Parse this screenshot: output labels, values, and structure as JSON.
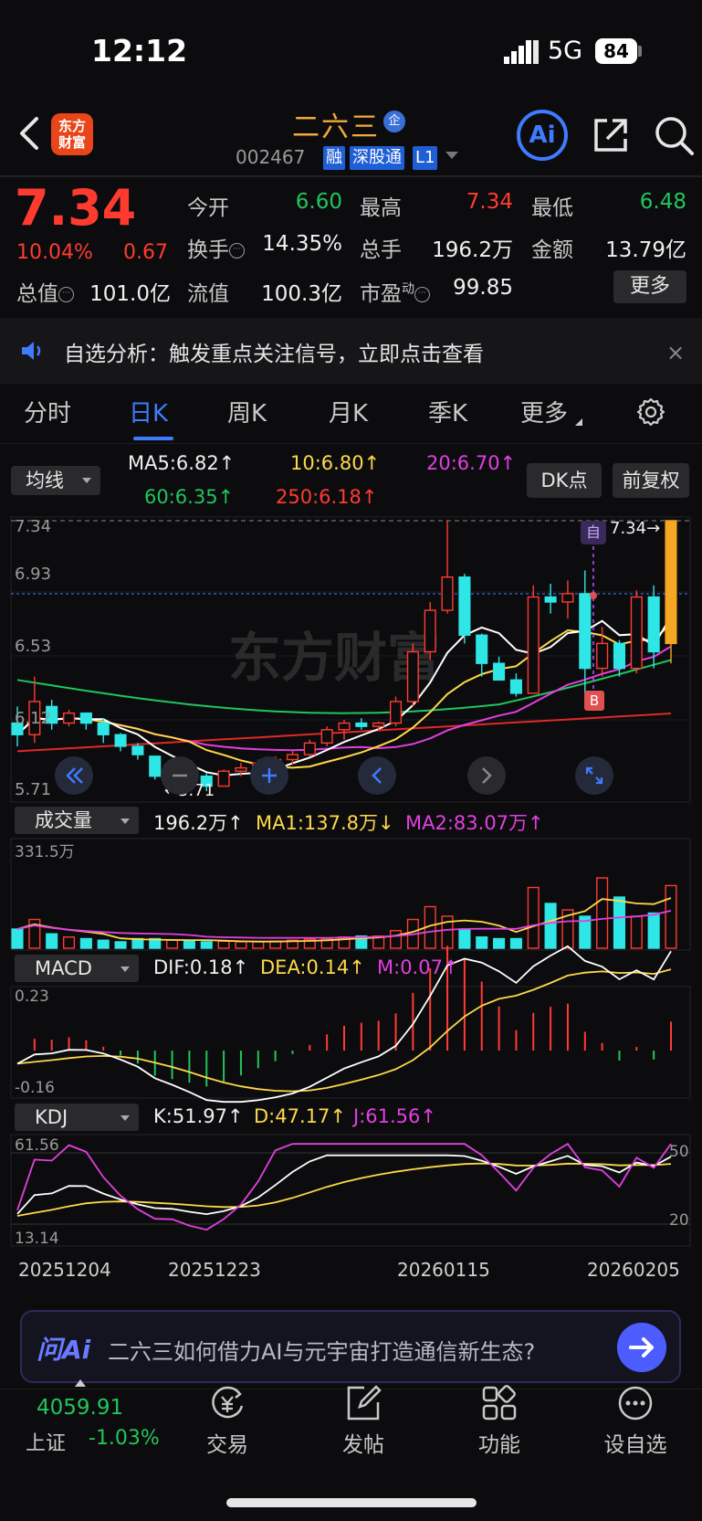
{
  "status_bar": {
    "time": "12:12",
    "network": "5G",
    "battery": "84"
  },
  "header": {
    "logo_line1": "东方",
    "logo_line2": "财富",
    "stock_name": "二六三",
    "qi_badge": "企",
    "stock_code": "002467",
    "tags": [
      "融",
      "深股通",
      "L1"
    ],
    "ai_label": "Ai"
  },
  "quote": {
    "price": "7.34",
    "change_pct": "10.04%",
    "change_abs": "0.67",
    "open_label": "今开",
    "open": "6.60",
    "high_label": "最高",
    "high": "7.34",
    "low_label": "最低",
    "low": "6.48",
    "turnover_label": "换手",
    "turnover": "14.35%",
    "volume_label": "总手",
    "volume": "196.2万",
    "amount_label": "金额",
    "amount": "13.79亿",
    "mktcap_label": "总值",
    "mktcap": "101.0亿",
    "float_label": "流值",
    "float_cap": "100.3亿",
    "pe_label": "市盈",
    "pe_super": "动",
    "pe": "99.85",
    "more_label": "更多",
    "colors": {
      "up": "#ff3b30",
      "down": "#21c55d"
    }
  },
  "notice": {
    "text": "自选分析：触发重点关注信号，立即点击查看",
    "close": "×"
  },
  "period_tabs": {
    "items": [
      "分时",
      "日K",
      "周K",
      "月K",
      "季K",
      "更多"
    ],
    "active": "日K"
  },
  "ma_row": {
    "selector": "均线",
    "ma5": "MA5:6.82↑",
    "ma10": "10:6.80↑",
    "ma20": "20:6.70↑",
    "ma60": "60:6.35↑",
    "ma250": "250:6.18↑",
    "dk_label": "DK点",
    "fq_label": "前复权"
  },
  "kline_panel": {
    "y_labels": [
      "7.34",
      "6.93",
      "6.53",
      "6.12",
      "5.71"
    ],
    "last_price_label": "7.34→",
    "min_label": "←5.71",
    "self_mark": "自",
    "buy_mark": "B",
    "watermark": "东方财富"
  },
  "volume_panel": {
    "selector": "成交量",
    "vol": "196.2万↑",
    "ma1": "MA1:137.8万↓",
    "ma2": "MA2:83.07万↑",
    "y_label": "331.5万"
  },
  "macd_panel": {
    "selector": "MACD",
    "dif": "DIF:0.18↑",
    "dea": "DEA:0.14↑",
    "m": "M:0.07↑",
    "y_top": "0.23",
    "y_bottom": "-0.16"
  },
  "kdj_panel": {
    "selector": "KDJ",
    "k": "K:51.97↑",
    "d": "D:47.17↑",
    "j": "J:61.56↑",
    "y_top": "61.56",
    "y_bottom": "13.14",
    "lvl_50": "50",
    "lvl_20": "20"
  },
  "date_axis": [
    "20251204",
    "20251223",
    "20260115",
    "20260205"
  ],
  "ai_bar": {
    "logo": "问Ai",
    "question": "二六三如何借力AI与元宇宙打造通信新生态?"
  },
  "bottom_nav": {
    "index_value": "4059.91",
    "index_name": "上证",
    "index_change": "-1.03%",
    "items": [
      "交易",
      "发帖",
      "功能",
      "设自选"
    ]
  },
  "chart_data": {
    "type": "candlestick",
    "ohlc": [
      [
        6.12,
        6.22,
        5.98,
        6.05
      ],
      [
        6.05,
        6.4,
        6.0,
        6.25
      ],
      [
        6.22,
        6.26,
        6.08,
        6.12
      ],
      [
        6.12,
        6.2,
        6.1,
        6.18
      ],
      [
        6.18,
        6.18,
        6.08,
        6.12
      ],
      [
        6.12,
        6.15,
        6.0,
        6.05
      ],
      [
        6.05,
        6.06,
        5.95,
        5.98
      ],
      [
        5.98,
        6.0,
        5.9,
        5.93
      ],
      [
        5.92,
        5.9,
        5.78,
        5.8
      ],
      [
        5.8,
        5.86,
        5.72,
        5.85
      ],
      [
        5.85,
        5.86,
        5.78,
        5.8
      ],
      [
        5.8,
        5.82,
        5.71,
        5.74
      ],
      [
        5.74,
        5.84,
        5.74,
        5.83
      ],
      [
        5.83,
        5.88,
        5.8,
        5.85
      ],
      [
        5.85,
        5.9,
        5.84,
        5.88
      ],
      [
        5.88,
        5.92,
        5.85,
        5.9
      ],
      [
        5.9,
        5.95,
        5.87,
        5.93
      ],
      [
        5.93,
        6.02,
        5.92,
        6.0
      ],
      [
        6.0,
        6.1,
        5.98,
        6.08
      ],
      [
        6.08,
        6.14,
        6.02,
        6.12
      ],
      [
        6.12,
        6.15,
        6.08,
        6.1
      ],
      [
        6.1,
        6.13,
        6.08,
        6.12
      ],
      [
        6.12,
        6.28,
        6.1,
        6.25
      ],
      [
        6.25,
        6.6,
        6.22,
        6.55
      ],
      [
        6.55,
        6.85,
        6.5,
        6.8
      ],
      [
        6.8,
        7.34,
        6.78,
        7.0
      ],
      [
        7.0,
        7.02,
        6.6,
        6.65
      ],
      [
        6.65,
        6.66,
        6.4,
        6.48
      ],
      [
        6.48,
        6.52,
        6.4,
        6.38
      ],
      [
        6.38,
        6.42,
        6.28,
        6.3
      ],
      [
        6.3,
        6.95,
        6.3,
        6.88
      ],
      [
        6.88,
        6.96,
        6.78,
        6.85
      ],
      [
        6.85,
        6.98,
        6.75,
        6.9
      ],
      [
        6.9,
        7.04,
        6.3,
        6.45
      ],
      [
        6.45,
        6.7,
        6.4,
        6.6
      ],
      [
        6.6,
        6.62,
        6.4,
        6.45
      ],
      [
        6.45,
        6.92,
        6.42,
        6.88
      ],
      [
        6.88,
        6.95,
        6.45,
        6.55
      ],
      [
        6.6,
        7.34,
        6.48,
        7.34
      ]
    ],
    "volume": [
      60,
      90,
      45,
      35,
      30,
      25,
      20,
      30,
      30,
      25,
      22,
      20,
      22,
      20,
      20,
      22,
      25,
      28,
      30,
      35,
      38,
      38,
      55,
      90,
      130,
      100,
      60,
      35,
      30,
      30,
      190,
      140,
      120,
      100,
      220,
      160,
      100,
      110,
      196
    ],
    "y_range": [
      5.71,
      7.34
    ],
    "volume_max": 331.5
  }
}
